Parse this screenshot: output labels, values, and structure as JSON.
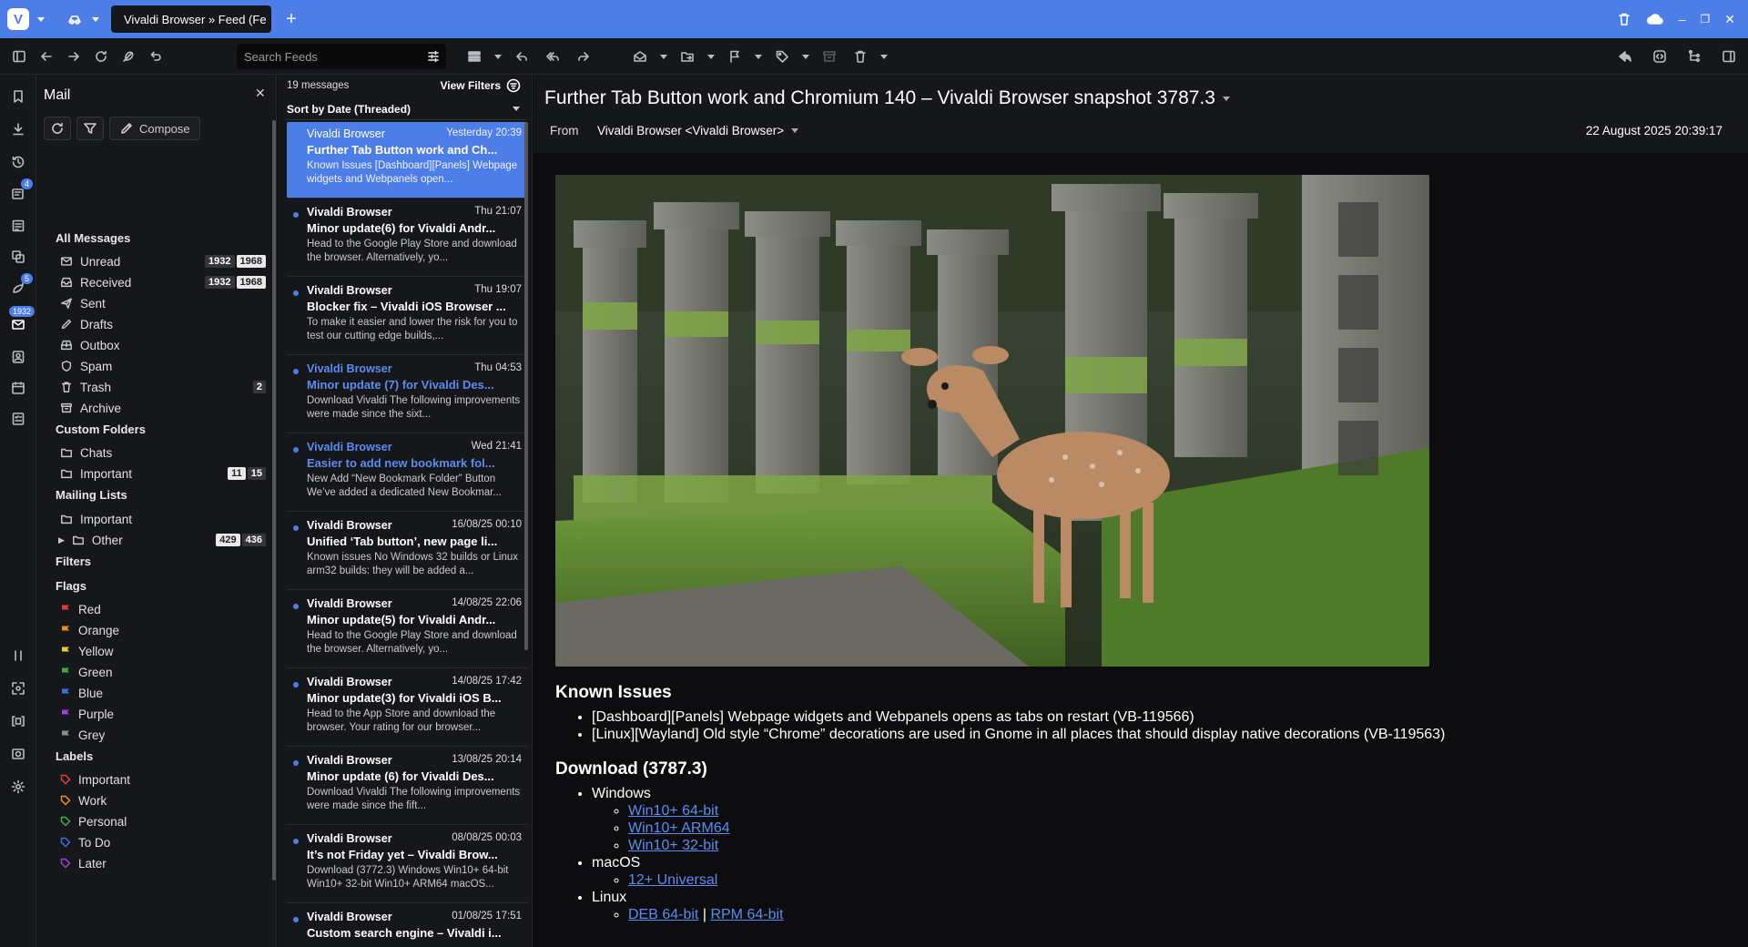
{
  "window": {
    "tab_title": "Vivaldi Browser » Feed (Fe",
    "brand_color": "#4d7de6"
  },
  "toolbar": {
    "search_placeholder": "Search Feeds"
  },
  "panel_badges": {
    "feeds": "4",
    "reader": "5",
    "mail": "1932"
  },
  "mail": {
    "title": "Mail",
    "compose": "Compose",
    "sections": {
      "all": "All Messages",
      "custom": "Custom Folders",
      "mailing": "Mailing Lists",
      "filters": "Filters",
      "flags": "Flags",
      "labels": "Labels"
    },
    "folders": [
      {
        "label": "Unread",
        "icon": "envelope-icon",
        "a": "1932",
        "b": "1968"
      },
      {
        "label": "Received",
        "icon": "inbox-icon",
        "a": "1932",
        "b": "1968"
      },
      {
        "label": "Sent",
        "icon": "send-icon"
      },
      {
        "label": "Drafts",
        "icon": "pencil-icon"
      },
      {
        "label": "Outbox",
        "icon": "outbox-icon"
      },
      {
        "label": "Spam",
        "icon": "shield-icon"
      },
      {
        "label": "Trash",
        "icon": "trash-icon",
        "b": "2"
      },
      {
        "label": "Archive",
        "icon": "archive-icon"
      }
    ],
    "custom_folders": [
      {
        "label": "Chats"
      },
      {
        "label": "Important",
        "a": "11",
        "b": "15"
      }
    ],
    "mailing_lists": [
      {
        "label": "Important"
      },
      {
        "label": "Other",
        "a": "429",
        "b": "436"
      }
    ],
    "flags": [
      {
        "label": "Red",
        "color": "#e23b3b"
      },
      {
        "label": "Orange",
        "color": "#f08a24"
      },
      {
        "label": "Yellow",
        "color": "#e6cf2b"
      },
      {
        "label": "Green",
        "color": "#3fae49"
      },
      {
        "label": "Blue",
        "color": "#3d6fe0"
      },
      {
        "label": "Purple",
        "color": "#a13fd1"
      },
      {
        "label": "Grey",
        "color": "#8a8c92"
      }
    ],
    "labels": [
      {
        "label": "Important",
        "color": "#e23b3b"
      },
      {
        "label": "Work",
        "color": "#f08a24"
      },
      {
        "label": "Personal",
        "color": "#3fae49"
      },
      {
        "label": "To Do",
        "color": "#3d6fe0"
      },
      {
        "label": "Later",
        "color": "#a13fd1"
      }
    ]
  },
  "list": {
    "count": "19 messages",
    "view_filters": "View Filters",
    "sort": "Sort by Date (Threaded)",
    "messages": [
      {
        "from": "Vivaldi Browser",
        "date": "Yesterday 20:39",
        "subject": "Further Tab Button work and Ch...",
        "preview": "Known Issues [Dashboard][Panels] Webpage widgets and Webpanels open...",
        "selected": true
      },
      {
        "from": "Vivaldi Browser",
        "date": "Thu 21:07",
        "subject": "Minor update(6) for Vivaldi Andr...",
        "preview": "Head to the Google Play Store and download the browser. Alternatively, yo..."
      },
      {
        "from": "Vivaldi Browser",
        "date": "Thu 19:07",
        "subject": "Blocker fix – Vivaldi iOS Browser ...",
        "preview": "To make it easier and lower the risk for you to test our cutting edge builds,..."
      },
      {
        "from": "Vivaldi Browser",
        "date": "Thu 04:53",
        "subject": "Minor update (7) for Vivaldi Des...",
        "preview": "Download Vivaldi The following improvements were made since the sixt...",
        "blue": true
      },
      {
        "from": "Vivaldi Browser",
        "date": "Wed 21:41",
        "subject": "Easier to add new bookmark fol...",
        "preview": "New Add “New Bookmark Folder” Button We’ve added a dedicated New Bookmar...",
        "blue": true
      },
      {
        "from": "Vivaldi Browser",
        "date": "16/08/25 00:10",
        "subject": "Unified ‘Tab button’, new page li...",
        "preview": "Known issues No Windows 32 builds or Linux arm32 builds: they will be added a..."
      },
      {
        "from": "Vivaldi Browser",
        "date": "14/08/25 22:06",
        "subject": "Minor update(5) for Vivaldi Andr...",
        "preview": "Head to the Google Play Store and download the browser. Alternatively, yo..."
      },
      {
        "from": "Vivaldi Browser",
        "date": "14/08/25 17:42",
        "subject": "Minor update(3) for Vivaldi iOS B...",
        "preview": "Head to the App Store and download the browser. Your rating for our browser..."
      },
      {
        "from": "Vivaldi Browser",
        "date": "13/08/25 20:14",
        "subject": "Minor update (6) for Vivaldi Des...",
        "preview": "Download Vivaldi The following improvements were made since the fift..."
      },
      {
        "from": "Vivaldi Browser",
        "date": "08/08/25 00:03",
        "subject": "It’s not Friday yet – Vivaldi Brow...",
        "preview": "Download (3772.3) Windows Win10+ 64-bit Win10+ 32-bit Win10+ ARM64 macOS..."
      },
      {
        "from": "Vivaldi Browser",
        "date": "01/08/25 17:51",
        "subject": "Custom search engine – Vivaldi i...",
        "preview": ""
      }
    ]
  },
  "reader": {
    "subject": "Further Tab Button work and Chromium 140 – Vivaldi Browser snapshot 3787.3",
    "from_label": "From",
    "from": "Vivaldi Browser <Vivaldi Browser>",
    "date": "22 August 2025 20:39:17",
    "known_issues_title": "Known Issues",
    "issues": [
      "[Dashboard][Panels] Webpage widgets and Webpanels opens as tabs on restart (VB-119566)",
      "[Linux][Wayland] Old style “Chrome” decorations are used in Gnome in all places that should display native decorations (VB-119563)"
    ],
    "download_title": "Download (3787.3)",
    "windows": "Windows",
    "win_links": [
      "Win10+ 64-bit",
      "Win10+ ARM64",
      "Win10+ 32-bit"
    ],
    "macos": "macOS",
    "mac_links": [
      "12+ Universal"
    ],
    "linux": "Linux",
    "linux_links": [
      "DEB 64-bit",
      "RPM 64-bit"
    ],
    "linux_sep": "|"
  }
}
